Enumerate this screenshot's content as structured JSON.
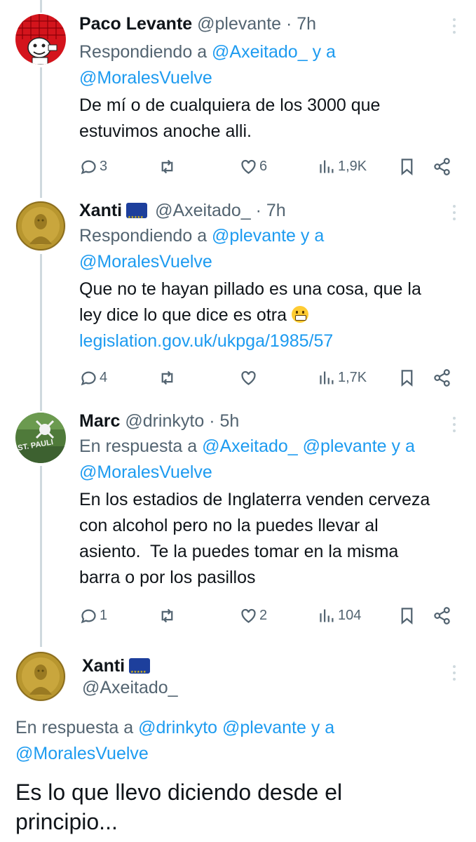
{
  "tweets": [
    {
      "name": "Paco Levante",
      "handle": "@plevante",
      "time": "7h",
      "reply_prefix": "Respondiendo a",
      "mention_1": "@Axeitado_",
      "reply_join": "y a",
      "mention_2": "@MoralesVuelve",
      "text_1": "De mí o de cualquiera de los 3000 que",
      "text_2": "estuvimos anoche alli.",
      "replies": "3",
      "retweets": "",
      "likes": "6",
      "views": "1,9K"
    },
    {
      "name": "Xanti",
      "handle": "@Axeitado_",
      "time": "7h",
      "reply_prefix": "Respondiendo a",
      "mention_1": "@plevante",
      "reply_join": "y a",
      "mention_2": "@MoralesVuelve",
      "text_1": "Que no te hayan pillado es una cosa, que la",
      "text_2": "ley dice lo que dice es otra",
      "link": "legislation.gov.uk/ukpga/1985/57",
      "replies": "4",
      "retweets": "",
      "likes": "",
      "views": "1,7K"
    },
    {
      "name": "Marc",
      "handle": "@drinkyto",
      "time": "5h",
      "reply_prefix": "En respuesta a",
      "mention_1": "@Axeitado_",
      "mention_1b": "@plevante",
      "reply_join": "y a",
      "mention_2": "@MoralesVuelve",
      "text_1": "En los estadios de Inglaterra venden cerveza",
      "text_2": "con alcohol pero no la puedes llevar al",
      "text_3": "asiento.  Te la puedes tomar en la misma",
      "text_4": "barra o por los pasillos",
      "replies": "1",
      "retweets": "",
      "likes": "2",
      "views": "104"
    }
  ],
  "focused": {
    "name": "Xanti",
    "handle": "@Axeitado_",
    "reply_prefix": "En respuesta a",
    "mention_1": "@drinkyto",
    "mention_1b": "@plevante",
    "reply_join": "y a",
    "mention_2": "@MoralesVuelve",
    "text_1": "Es lo que llevo diciendo desde el",
    "text_2": "principio..."
  },
  "icons": {
    "reply": "comment-icon",
    "retweet": "retweet-icon",
    "like": "heart-icon",
    "views": "views-chart-icon",
    "bookmark": "bookmark-icon",
    "share": "share-icon",
    "more": "more-vertical-icon",
    "flag": "eu-flag-icon"
  },
  "colors": {
    "link": "#1d9bf0",
    "secondary_text": "#536471",
    "thread_line": "#cfd9de"
  }
}
